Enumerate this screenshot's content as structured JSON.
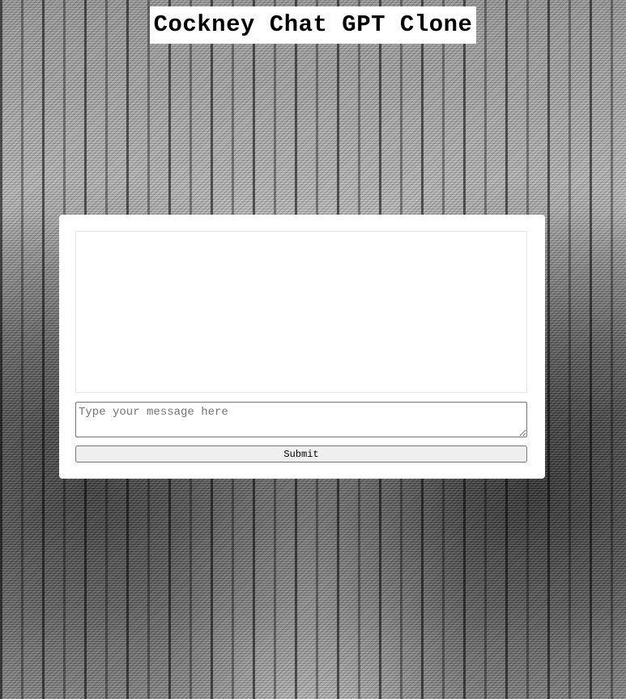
{
  "header": {
    "title": "Cockney Chat GPT Clone"
  },
  "chat": {
    "messages": [],
    "input": {
      "value": "",
      "placeholder": "Type your message here"
    },
    "submit_label": "Submit"
  },
  "colors": {
    "panel_background": "#ffffff",
    "title_background": "#ffffff",
    "button_background": "#efefef",
    "input_border": "#767676"
  }
}
